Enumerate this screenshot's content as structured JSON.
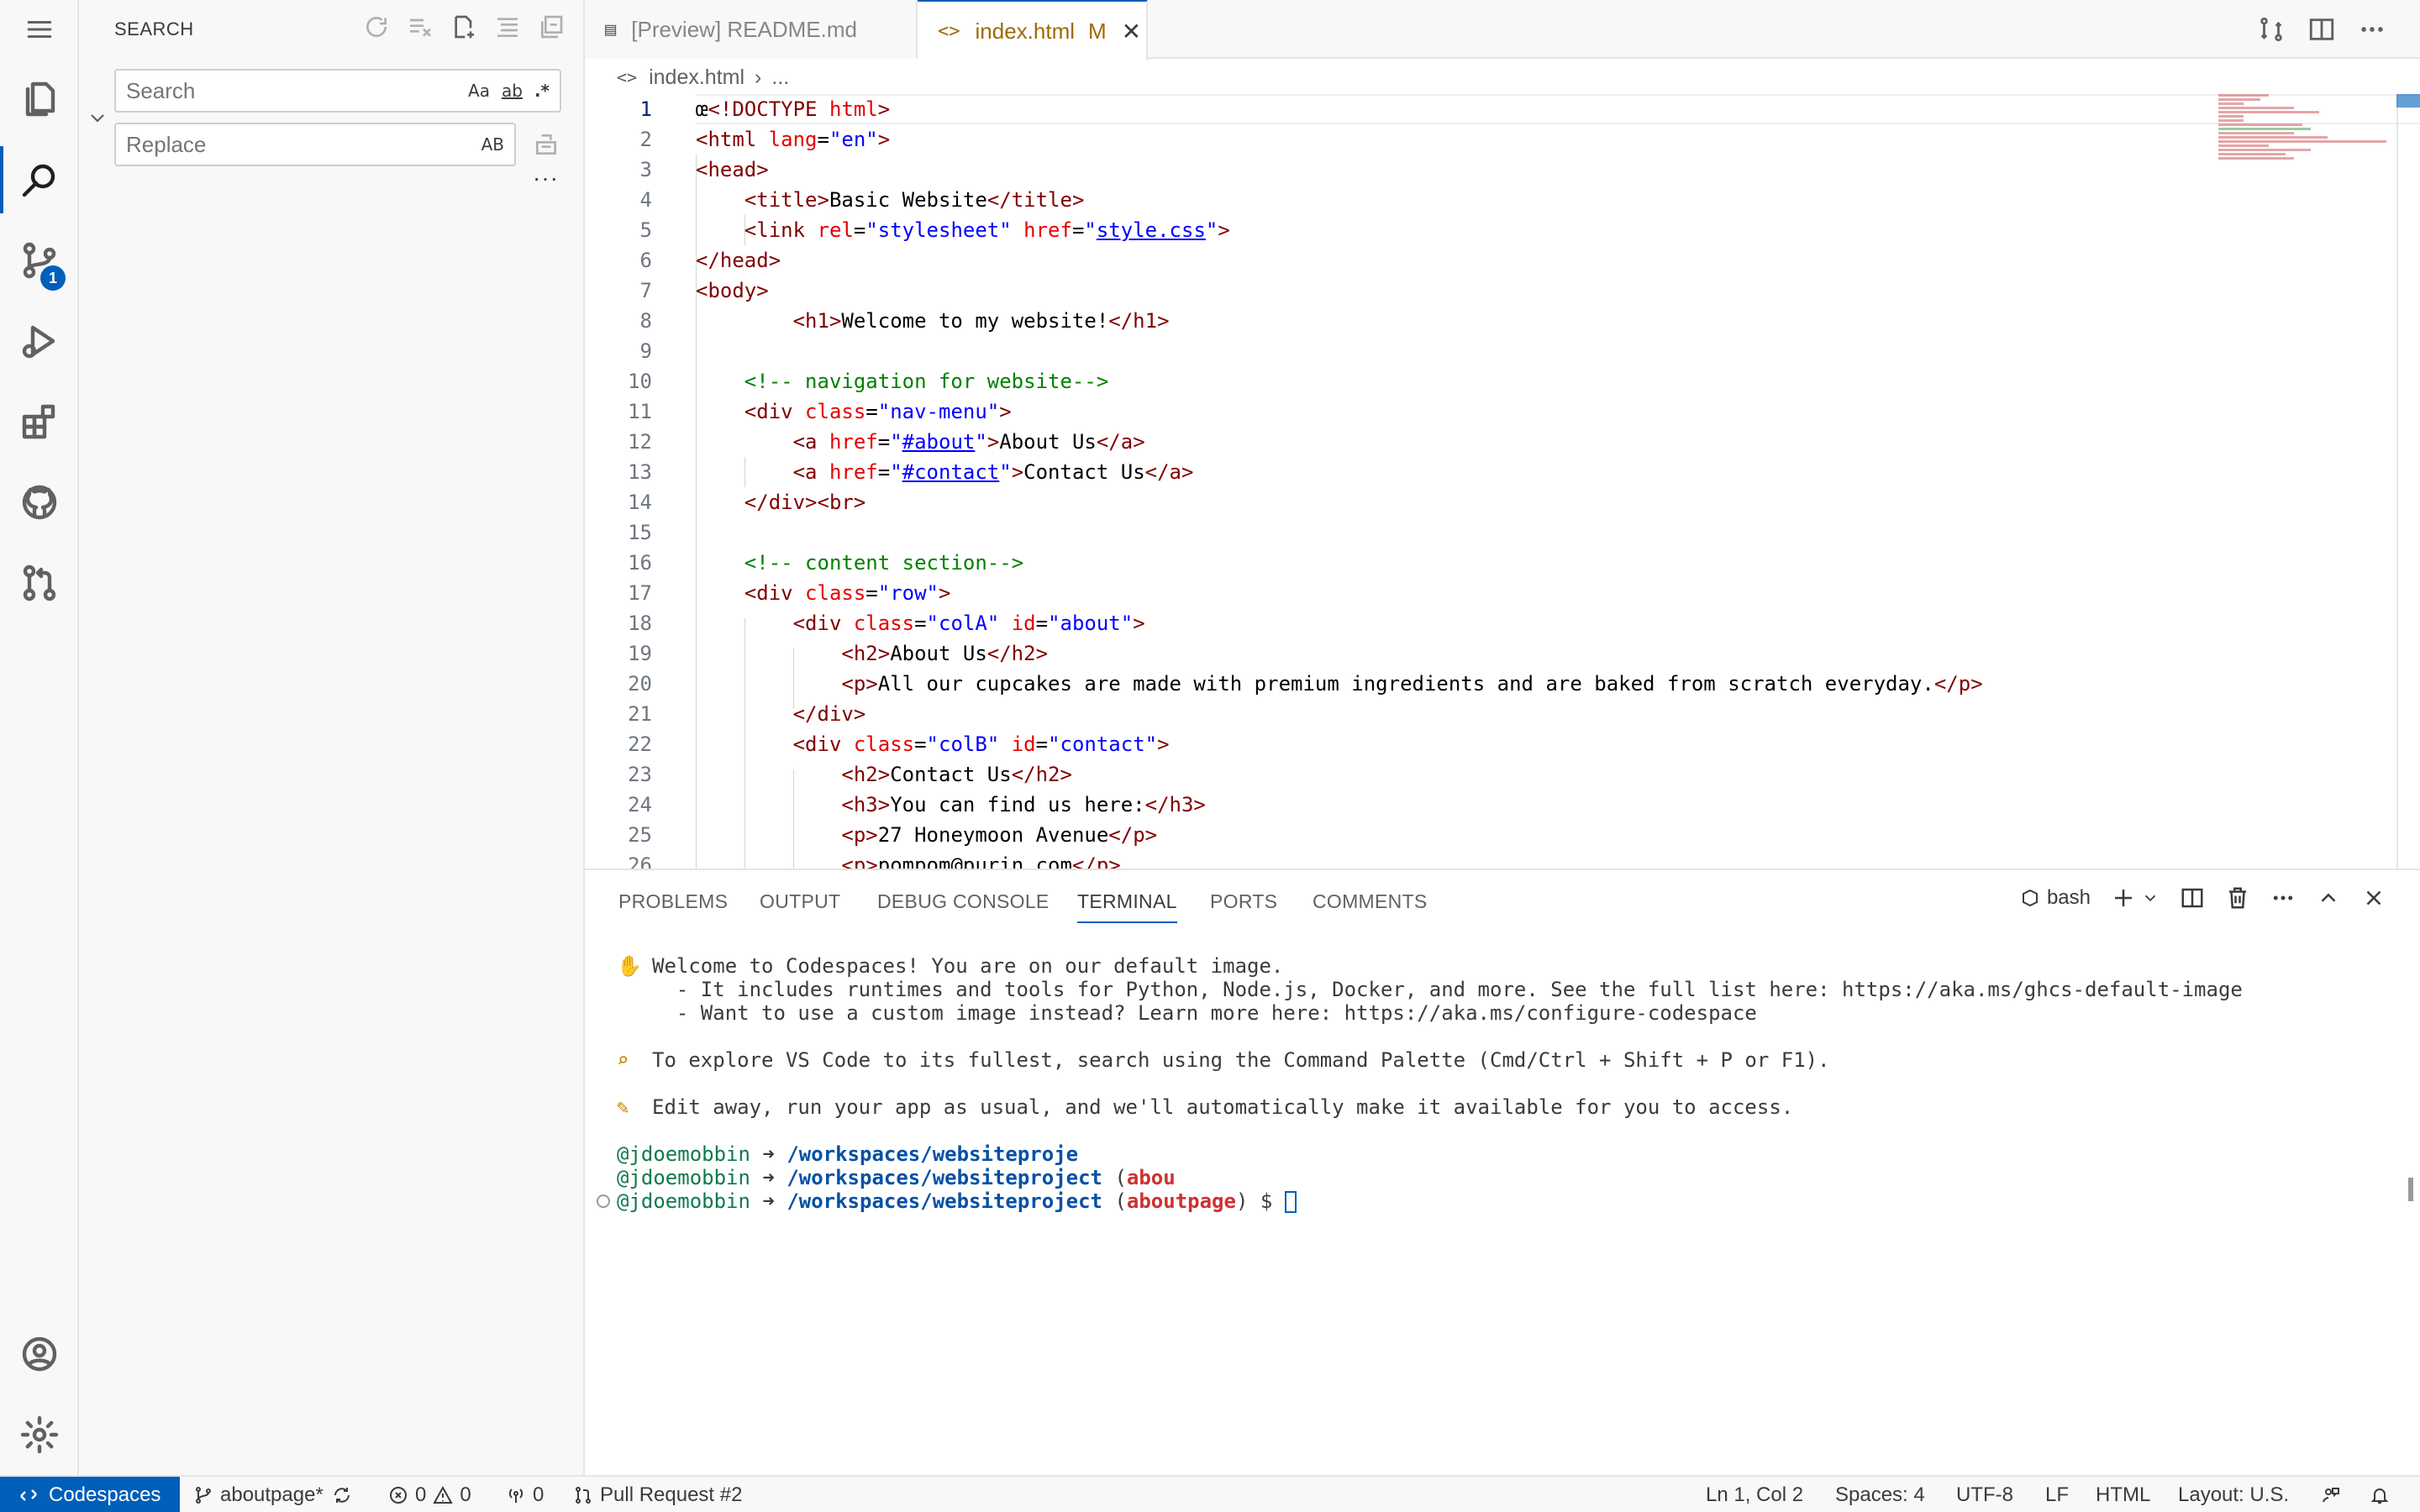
{
  "activity_bar": {
    "items": [
      "explorer-icon",
      "search-icon",
      "source-control-icon",
      "run-debug-icon",
      "extensions-icon",
      "github-icon",
      "pull-requests-icon"
    ],
    "source_control_badge": "1",
    "bottom": [
      "account-icon",
      "settings-gear-icon"
    ]
  },
  "sidebar": {
    "title": "SEARCH",
    "search_placeholder": "Search",
    "replace_placeholder": "Replace",
    "opt_case": "Aa",
    "opt_word": "ab",
    "opt_regex": ".*",
    "opt_preserve_case": "AB",
    "more": "···"
  },
  "tabs": [
    {
      "label": "[Preview] README.md",
      "icon": "preview-icon"
    },
    {
      "label": "index.html",
      "modified": "M",
      "close": "✕",
      "icon": "html-icon"
    }
  ],
  "breadcrumb": {
    "file": "index.html",
    "rest": "..."
  },
  "editor": {
    "line_numbers": [
      "1",
      "2",
      "3",
      "4",
      "5",
      "6",
      "7",
      "8",
      "9",
      "10",
      "11",
      "12",
      "13",
      "14",
      "15",
      "16",
      "17",
      "18",
      "19",
      "20",
      "21",
      "22",
      "23",
      "24",
      "25",
      "26"
    ]
  },
  "panel": {
    "tabs": [
      "PROBLEMS",
      "OUTPUT",
      "DEBUG CONSOLE",
      "TERMINAL",
      "PORTS",
      "COMMENTS"
    ],
    "shell": "bash",
    "terminal": {
      "welcome": "Welcome to Codespaces! You are on our default image.",
      "bullet1": "  - It includes runtimes and tools for Python, Node.js, Docker, and more. See the full list here: https://aka.ms/ghcs-default-image",
      "bullet2": "  - Want to use a custom image instead? Learn more here: https://aka.ms/configure-codespace",
      "explore": "To explore VS Code to its fullest, search using the Command Palette (Cmd/Ctrl + Shift + P or F1).",
      "edit": "Edit away, run your app as usual, and we'll automatically make it available for you to access.",
      "user": "@jdoemobbin",
      "arrow": "➜",
      "path_short": "/workspaces/websiteproje",
      "path": "/workspaces/websiteproject",
      "branch_partial": "abou",
      "branch": "aboutpage",
      "prompt": "$"
    }
  },
  "status_bar": {
    "remote": "Codespaces",
    "branch": "aboutpage*",
    "errors": "0",
    "warnings": "0",
    "ports": "0",
    "pull_request": "Pull Request #2",
    "position": "Ln 1, Col 2",
    "spaces": "Spaces: 4",
    "encoding": "UTF-8",
    "eol": "LF",
    "language": "HTML",
    "layout": "Layout: U.S."
  }
}
